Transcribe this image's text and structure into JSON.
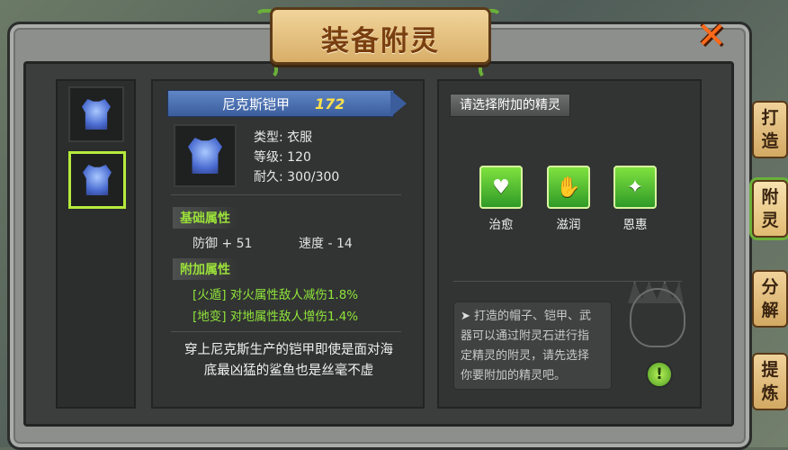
{
  "window": {
    "title": "装备附灵",
    "close_icon": "close-x-icon",
    "accent": "#ff6a1a"
  },
  "side_tabs": [
    {
      "label": "打造",
      "active": false
    },
    {
      "label": "附灵",
      "active": true
    },
    {
      "label": "分解",
      "active": false
    },
    {
      "label": "提炼",
      "active": false
    }
  ],
  "equipment_list": [
    {
      "icon": "armor-icon",
      "selected": false
    },
    {
      "icon": "armor-icon",
      "selected": true
    }
  ],
  "item": {
    "name": "尼克斯铠甲",
    "level": "172",
    "type_line": "类型: 衣服",
    "grade_line": "等级: 120",
    "durability_line": "耐久: 300/300",
    "base_title": "基础属性",
    "defense": "防御 + 51",
    "speed": "速度 - 14",
    "extra_title": "附加属性",
    "extra1": "[火遁] 对火属性敌人减伤1.8%",
    "extra2": "[地变] 对地属性敌人增伤1.4%",
    "desc1": "穿上尼克斯生产的铠甲即使是面对海",
    "desc2": "底最凶猛的鲨鱼也是丝毫不虚",
    "name_bar_color": "#4a70b2",
    "attr_color": "#9be03a"
  },
  "spirit_panel": {
    "title": "请选择附加的精灵",
    "spirits": [
      {
        "label": "治愈",
        "icon": "heal-spirit-icon"
      },
      {
        "label": "滋润",
        "icon": "nourish-spirit-icon"
      },
      {
        "label": "恩惠",
        "icon": "grace-spirit-icon"
      }
    ],
    "tip1": "打造的帽子、铠甲、武",
    "tip2": "器可以通过附灵石进行指",
    "tip3": "定精灵的附灵，请先选择",
    "tip4": "你要附加的精灵吧。",
    "alert_icon": "exclamation-icon",
    "spirit_color": "#4fbf30"
  }
}
